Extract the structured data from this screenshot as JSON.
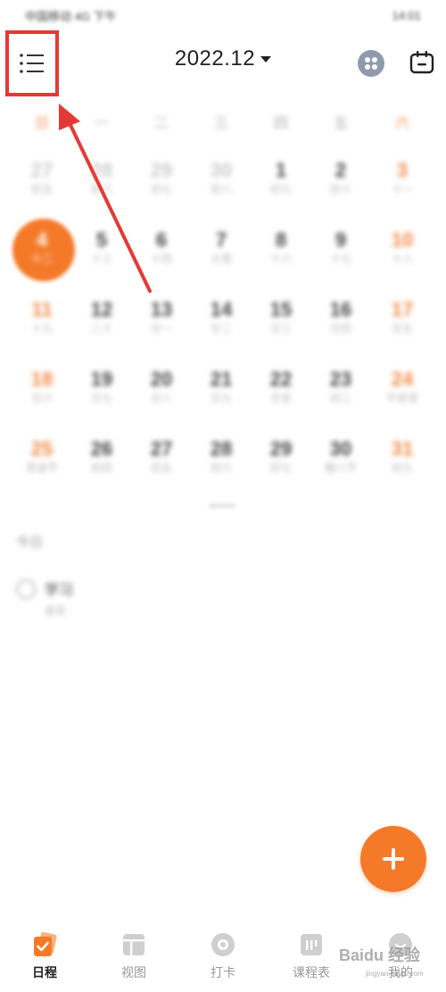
{
  "status_bar": {
    "left": "中国移动 4G 下午",
    "right": "14:01"
  },
  "header": {
    "month_title": "2022.12"
  },
  "calendar": {
    "weekdays": [
      "日",
      "一",
      "二",
      "三",
      "四",
      "五",
      "六"
    ],
    "weeks": [
      [
        {
          "num": "27",
          "sub": "初五",
          "other": true
        },
        {
          "num": "28",
          "sub": "初六",
          "other": true
        },
        {
          "num": "29",
          "sub": "初七",
          "other": true
        },
        {
          "num": "30",
          "sub": "初八",
          "other": true
        },
        {
          "num": "1",
          "sub": "初九"
        },
        {
          "num": "2",
          "sub": "初十"
        },
        {
          "num": "3",
          "sub": "十一"
        }
      ],
      [
        {
          "num": "4",
          "sub": "十二",
          "today": true
        },
        {
          "num": "5",
          "sub": "十三"
        },
        {
          "num": "6",
          "sub": "十四"
        },
        {
          "num": "7",
          "sub": "大雪"
        },
        {
          "num": "8",
          "sub": "十六"
        },
        {
          "num": "9",
          "sub": "十七"
        },
        {
          "num": "10",
          "sub": "十八"
        }
      ],
      [
        {
          "num": "11",
          "sub": "十九"
        },
        {
          "num": "12",
          "sub": "二十"
        },
        {
          "num": "13",
          "sub": "廿一"
        },
        {
          "num": "14",
          "sub": "廿二"
        },
        {
          "num": "15",
          "sub": "廿三"
        },
        {
          "num": "16",
          "sub": "廿四"
        },
        {
          "num": "17",
          "sub": "廿五"
        }
      ],
      [
        {
          "num": "18",
          "sub": "廿六"
        },
        {
          "num": "19",
          "sub": "廿七"
        },
        {
          "num": "20",
          "sub": "廿八"
        },
        {
          "num": "21",
          "sub": "廿九"
        },
        {
          "num": "22",
          "sub": "冬至"
        },
        {
          "num": "23",
          "sub": "初二"
        },
        {
          "num": "24",
          "sub": "平安夜"
        }
      ],
      [
        {
          "num": "25",
          "sub": "圣诞节"
        },
        {
          "num": "26",
          "sub": "初四"
        },
        {
          "num": "27",
          "sub": "初五"
        },
        {
          "num": "28",
          "sub": "初六"
        },
        {
          "num": "29",
          "sub": "初七"
        },
        {
          "num": "30",
          "sub": "腊八节"
        },
        {
          "num": "31",
          "sub": "初九"
        }
      ]
    ]
  },
  "today_section": {
    "label": "今日",
    "todo": {
      "title": "学习",
      "meta": "全天"
    }
  },
  "tabs": [
    {
      "label": "日程",
      "active": true,
      "icon": "schedule-check-icon"
    },
    {
      "label": "视图",
      "active": false,
      "icon": "view-layout-icon"
    },
    {
      "label": "打卡",
      "active": false,
      "icon": "checkin-target-icon"
    },
    {
      "label": "课程表",
      "active": false,
      "icon": "timetable-icon"
    },
    {
      "label": "我的",
      "active": false,
      "icon": "profile-icon"
    }
  ],
  "watermark": {
    "text": "Baidu 经验",
    "sub": "jingyan.baidu.com"
  },
  "colors": {
    "accent": "#f47a2a",
    "highlight_box": "#e53935",
    "weekend": "#f08a45"
  }
}
